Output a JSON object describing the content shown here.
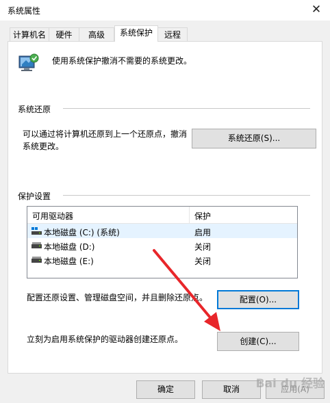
{
  "window": {
    "title": "系统属性",
    "close_glyph": "✕"
  },
  "tabs": [
    {
      "label": "计算机名",
      "active": false
    },
    {
      "label": "硬件",
      "active": false
    },
    {
      "label": "高级",
      "active": false
    },
    {
      "label": "系统保护",
      "active": true
    },
    {
      "label": "远程",
      "active": false
    }
  ],
  "header": {
    "description": "使用系统保护撤消不需要的系统更改。"
  },
  "restore": {
    "section_title": "系统还原",
    "description_line1": "可以通过将计算机还原到上一个还原点，撤消",
    "description_line2": "系统更改。",
    "button_label": "系统还原(S)..."
  },
  "protection": {
    "section_title": "保护设置",
    "columns": [
      "可用驱动器",
      "保护"
    ],
    "rows": [
      {
        "drive": "本地磁盘 (C:) (系统)",
        "status": "启用",
        "system": true
      },
      {
        "drive": "本地磁盘 (D:)",
        "status": "关闭",
        "system": false
      },
      {
        "drive": "本地磁盘 (E:)",
        "status": "关闭",
        "system": false
      }
    ],
    "configure_text": "配置还原设置、管理磁盘空间，并且删除还原点。",
    "configure_button": "配置(O)...",
    "create_text": "立刻为启用系统保护的驱动器创建还原点。",
    "create_button": "创建(C)..."
  },
  "footer": {
    "ok_label": "确定",
    "cancel_label": "取消",
    "apply_label": "应用(A)"
  },
  "watermark": "Bai du 经验",
  "colors": {
    "accent": "#0078d7",
    "annotation_arrow": "#e8262a",
    "selection": "#e5f3ff"
  }
}
